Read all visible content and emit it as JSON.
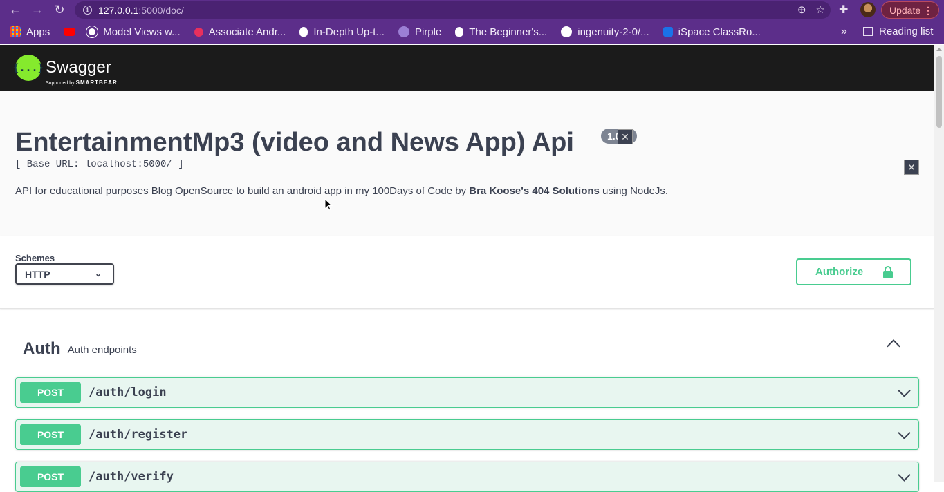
{
  "browser": {
    "url_host": "127.0.0.1",
    "url_path": ":5000/doc/",
    "update_label": "Update",
    "reading_list_label": "Reading list",
    "bookmarks": [
      {
        "label": "Apps",
        "color": "#e94235"
      },
      {
        "label": "",
        "color": "#ff0000"
      },
      {
        "label": "Model Views w...",
        "color": "#ffffff"
      },
      {
        "label": "Associate Andr...",
        "color": "#e8305d"
      },
      {
        "label": "In-Depth Up-t...",
        "color": "#ffffff"
      },
      {
        "label": "Pirple",
        "color": "#9b7fd4"
      },
      {
        "label": "The Beginner's...",
        "color": "#ffffff"
      },
      {
        "label": "ingenuity-2-0/...",
        "color": "#ffffff"
      },
      {
        "label": "iSpace ClassRo...",
        "color": "#1a73e8"
      }
    ]
  },
  "swagger": {
    "brand": "Swagger",
    "supported_by": "Supported by",
    "smartbear": "SMARTBEAR",
    "logo_glyph": "{...}"
  },
  "info": {
    "title": "EntertainmentMp3 (video and News App) Api",
    "version": "1.0",
    "base_url": "[ Base URL: localhost:5000/ ]",
    "description_pre": "API for educational purposes Blog OpenSource to build an android app in my 100Days of Code by ",
    "description_bold": "Bra Koose's 404 Solutions",
    "description_post": " using NodeJs."
  },
  "schemes": {
    "label": "Schemes",
    "selected": "HTTP"
  },
  "authorize": {
    "label": "Authorize"
  },
  "tag": {
    "name": "Auth",
    "description": "Auth endpoints"
  },
  "operations": [
    {
      "method": "POST",
      "path": "/auth/login"
    },
    {
      "method": "POST",
      "path": "/auth/register"
    },
    {
      "method": "POST",
      "path": "/auth/verify"
    }
  ],
  "colors": {
    "chrome": "#5c2e8a",
    "post": "#49cc90",
    "text": "#3b4151"
  }
}
